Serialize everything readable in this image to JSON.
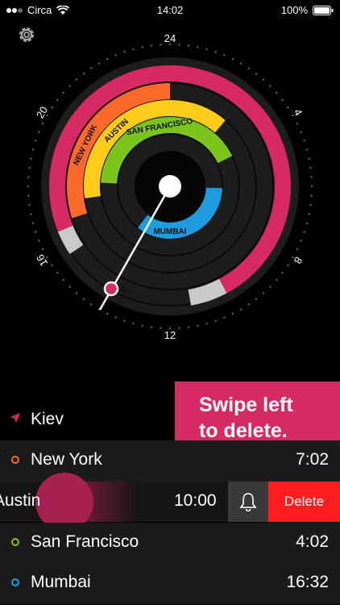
{
  "status_bar": {
    "carrier": "Circa",
    "time": "14:02",
    "battery": "100%"
  },
  "dial": {
    "hour_labels": [
      "24",
      "4",
      "8",
      "12",
      "16",
      "20"
    ],
    "rings": [
      {
        "city": "NEW YORK",
        "color": "#ff6a2a"
      },
      {
        "city": "AUSTIN",
        "color": "#ffcc1a"
      },
      {
        "city": "SAN FRANCISCO",
        "color": "#7bc41c"
      },
      {
        "city": "MUMBAI",
        "color": "#1f9be0"
      },
      {
        "city": "KIEV",
        "color": "#d72a63"
      }
    ]
  },
  "toast": {
    "line1": "Swipe left",
    "line2": "to delete."
  },
  "cities": [
    {
      "name": "Kiev",
      "time": "",
      "current": true
    },
    {
      "name": "New York",
      "time": "7:02",
      "color": "#ff6a2a"
    },
    {
      "name": "Austin",
      "time": "10:00",
      "color": "#ffcc1a"
    },
    {
      "name": "San Francisco",
      "time": "4:02",
      "color": "#7bc41c"
    },
    {
      "name": "Mumbai",
      "time": "16:32",
      "color": "#1f9be0"
    }
  ],
  "swipe_actions": {
    "delete_label": "Delete",
    "alarm_icon": "bell-icon"
  },
  "colors": {
    "accent": "#d72a63",
    "delete": "#ff1f1f"
  }
}
